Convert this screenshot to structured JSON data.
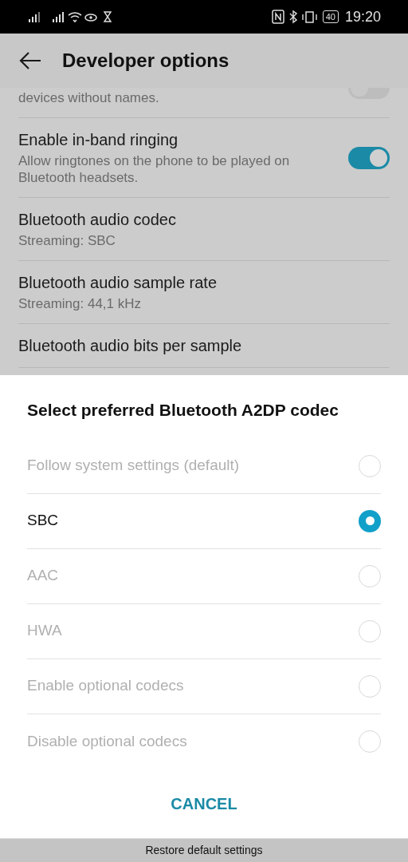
{
  "status_bar": {
    "battery": "40",
    "time": "19:20"
  },
  "header": {
    "title": "Developer options"
  },
  "settings": [
    {
      "subtitle": "devices without names.",
      "kind": "toggle",
      "on": false
    },
    {
      "title": "Enable in-band ringing",
      "subtitle": "Allow ringtones on the phone to be played on Bluetooth headsets.",
      "kind": "toggle",
      "on": true
    },
    {
      "title": "Bluetooth audio codec",
      "subtitle": "Streaming: SBC",
      "kind": "plain"
    },
    {
      "title": "Bluetooth audio sample rate",
      "subtitle": "Streaming: 44,1 kHz",
      "kind": "plain"
    },
    {
      "title": "Bluetooth audio bits per sample",
      "kind": "plain"
    }
  ],
  "dialog": {
    "title": "Select preferred Bluetooth A2DP codec",
    "options": [
      {
        "label": "Follow system settings (default)",
        "selected": false,
        "disabled": true
      },
      {
        "label": "SBC",
        "selected": true,
        "disabled": false
      },
      {
        "label": "AAC",
        "selected": false,
        "disabled": true
      },
      {
        "label": "HWA",
        "selected": false,
        "disabled": true
      },
      {
        "label": "Enable optional codecs",
        "selected": false,
        "disabled": true
      },
      {
        "label": "Disable optional codecs",
        "selected": false,
        "disabled": true
      }
    ],
    "cancel": "CANCEL"
  },
  "bottom_bar": {
    "label": "Restore default settings"
  }
}
